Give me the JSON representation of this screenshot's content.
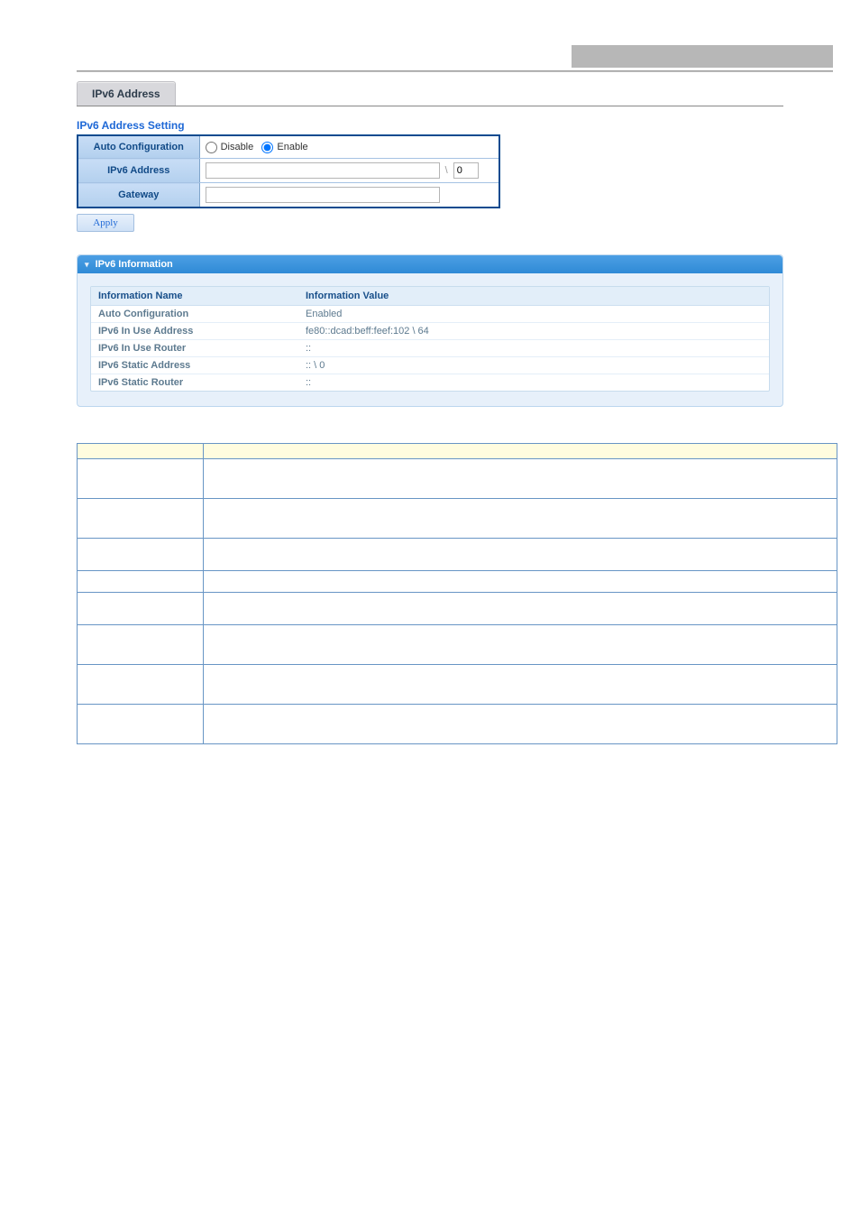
{
  "page": {
    "title": "IPv6 Address",
    "section_heading": "IPv6 Address Setting",
    "settings": {
      "auto_conf_label": "Auto Configuration",
      "disable_label": "Disable",
      "enable_label": "Enable",
      "auto_conf_value": "enable",
      "ipv6_addr_label": "IPv6 Address",
      "ipv6_addr_value": "",
      "ipv6_prefix_value": "0",
      "gateway_label": "Gateway",
      "gateway_value": ""
    },
    "apply_label": "Apply"
  },
  "info_panel": {
    "header": "IPv6 Information",
    "col_name": "Information Name",
    "col_value": "Information Value",
    "rows": [
      {
        "name": "Auto Configuration",
        "value": "Enabled"
      },
      {
        "name": "IPv6 In Use Address",
        "value": "fe80::dcad:beff:feef:102 \\ 64"
      },
      {
        "name": "IPv6 In Use Router",
        "value": "::"
      },
      {
        "name": "IPv6 Static Address",
        "value": ":: \\ 0"
      },
      {
        "name": "IPv6 Static Router",
        "value": "::"
      }
    ]
  },
  "desc_table": {
    "headers": [
      "",
      ""
    ],
    "rows": [
      {
        "obj": "",
        "desc": ""
      },
      {
        "obj": "",
        "desc": ""
      },
      {
        "obj": "",
        "desc": ""
      },
      {
        "obj": "",
        "desc": ""
      },
      {
        "obj": "",
        "desc": ""
      },
      {
        "obj": "",
        "desc": ""
      },
      {
        "obj": "",
        "desc": ""
      },
      {
        "obj": "",
        "desc": ""
      }
    ]
  }
}
